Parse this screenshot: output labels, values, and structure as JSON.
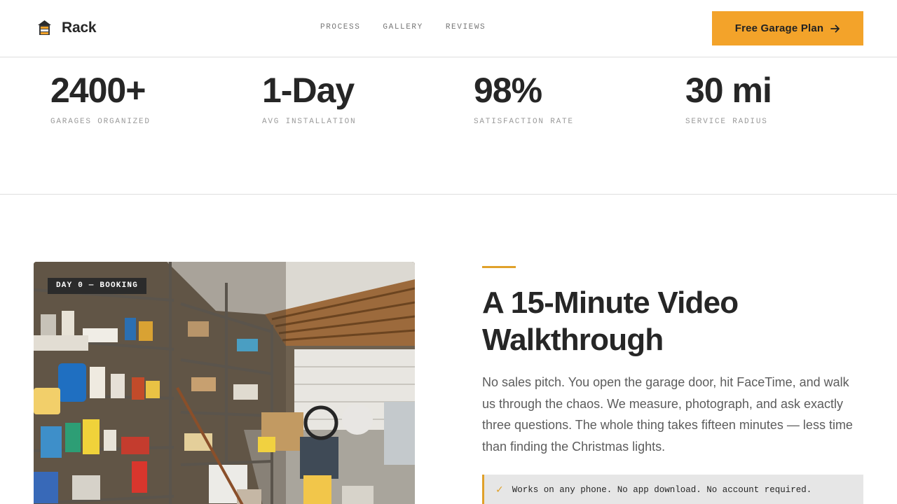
{
  "brand": {
    "name": "Rack",
    "icon": "house-shelving-logo-icon"
  },
  "nav": {
    "items": [
      {
        "label": "PROCESS"
      },
      {
        "label": "GALLERY"
      },
      {
        "label": "REVIEWS"
      }
    ]
  },
  "cta": {
    "label": "Free Garage Plan",
    "icon": "arrow-right-icon",
    "color": "#f3a32a"
  },
  "stats": [
    {
      "value": "2400+",
      "label": "GARAGES ORGANIZED"
    },
    {
      "value": "1-Day",
      "label": "AVG INSTALLATION"
    },
    {
      "value": "98%",
      "label": "SATISFACTION RATE"
    },
    {
      "value": "30 mi",
      "label": "SERVICE RADIUS"
    }
  ],
  "feature": {
    "image_badge": "DAY 0 — BOOKING",
    "image_subject": "cluttered garage with shelving",
    "title": "A 15-Minute Video Walkthrough",
    "body": "No sales pitch. You open the garage door, hit FaceTime, and walk us through the chaos. We measure, photograph, and ask exactly three questions. The whole thing takes fifteen minutes — less time than finding the Christmas lights.",
    "note": "Works on any phone. No app download. No account required.",
    "note_icon": "checkmark-icon",
    "accent_color": "#e0a12a"
  }
}
